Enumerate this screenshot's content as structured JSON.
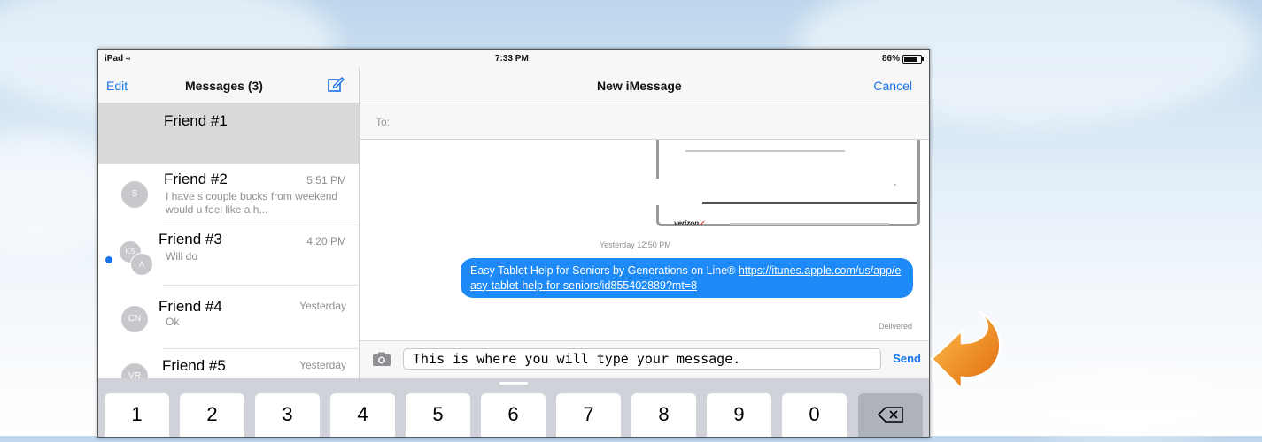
{
  "status_bar": {
    "device": "iPad",
    "time": "7:33 PM",
    "battery": "86%",
    "battery_level": 0.86
  },
  "master": {
    "nav": {
      "edit": "Edit",
      "title": "Messages (3)",
      "compose_icon": "compose-icon"
    },
    "conversations": [
      {
        "name": "Friend #1",
        "time": "",
        "snippet": "",
        "avatar": "",
        "unread": false,
        "selected": true
      },
      {
        "name": "Friend #2",
        "time": "5:51 PM",
        "snippet": "I have s couple bucks from weekend would u  feel like a h...",
        "avatar": "S",
        "unread": false,
        "selected": false
      },
      {
        "name": "Friend #3",
        "time": "4:20 PM",
        "snippet": "Will do",
        "avatar": "KS",
        "avatar2": "A",
        "unread": true,
        "selected": false
      },
      {
        "name": "Friend #4",
        "time": "Yesterday",
        "snippet": "Ok",
        "avatar": "CN",
        "unread": false,
        "selected": false
      },
      {
        "name": "Friend #5",
        "time": "Yesterday",
        "snippet": "",
        "avatar": "VR",
        "unread": false,
        "selected": false
      }
    ]
  },
  "detail": {
    "nav": {
      "title": "New iMessage",
      "cancel": "Cancel"
    },
    "to_label": "To:",
    "card_brand": "verizon",
    "timestamp_prefix": "Yesterday",
    "timestamp_time": "12:50 PM",
    "message": {
      "text": "Easy Tablet Help for Seniors by Generations on Line® ",
      "link": "https://itunes.apple.com/us/app/easy-tablet-help-for-seniors/id855402889?mt=8"
    },
    "delivered": "Delivered",
    "input": {
      "value": "This is where you will type your message.",
      "camera_icon": "camera-icon"
    },
    "send": "Send"
  },
  "keyboard": {
    "keys": [
      "1",
      "2",
      "3",
      "4",
      "5",
      "6",
      "7",
      "8",
      "9",
      "0"
    ],
    "delete_icon": "delete-key-icon"
  },
  "annotation": {
    "arrow_icon": "orange-curved-arrow-icon",
    "arrow_color": "#f08a1c"
  },
  "colors": {
    "accent": "#1a73e8",
    "bubble": "#1e8af8",
    "unread": "#1a73e8"
  }
}
